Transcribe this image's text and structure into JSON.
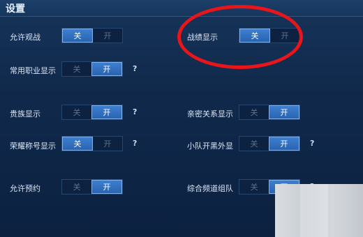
{
  "header": {
    "title": "设置"
  },
  "toggle_labels": {
    "off": "关",
    "on": "开"
  },
  "help_glyph": "?",
  "settings": [
    {
      "label": "允许观战",
      "state": "off"
    },
    {
      "label": "战绩显示",
      "state": "off"
    },
    {
      "label": "常用职业显示",
      "state": "on",
      "help": true
    },
    {
      "label": "贵族显示",
      "state": "on",
      "help": true
    },
    {
      "label": "亲密关系显示",
      "state": "on"
    },
    {
      "label": "荣耀称号显示",
      "state": "off",
      "help": true
    },
    {
      "label": "小队开黑外显",
      "state": "on",
      "help": true
    },
    {
      "label": "允许预约",
      "state": "on"
    },
    {
      "label": "综合频道组队",
      "state": "on",
      "help": true
    }
  ],
  "colors": {
    "accent": "#3e7fd0",
    "background": "#10294b",
    "highlight_ring": "#e8151a"
  }
}
